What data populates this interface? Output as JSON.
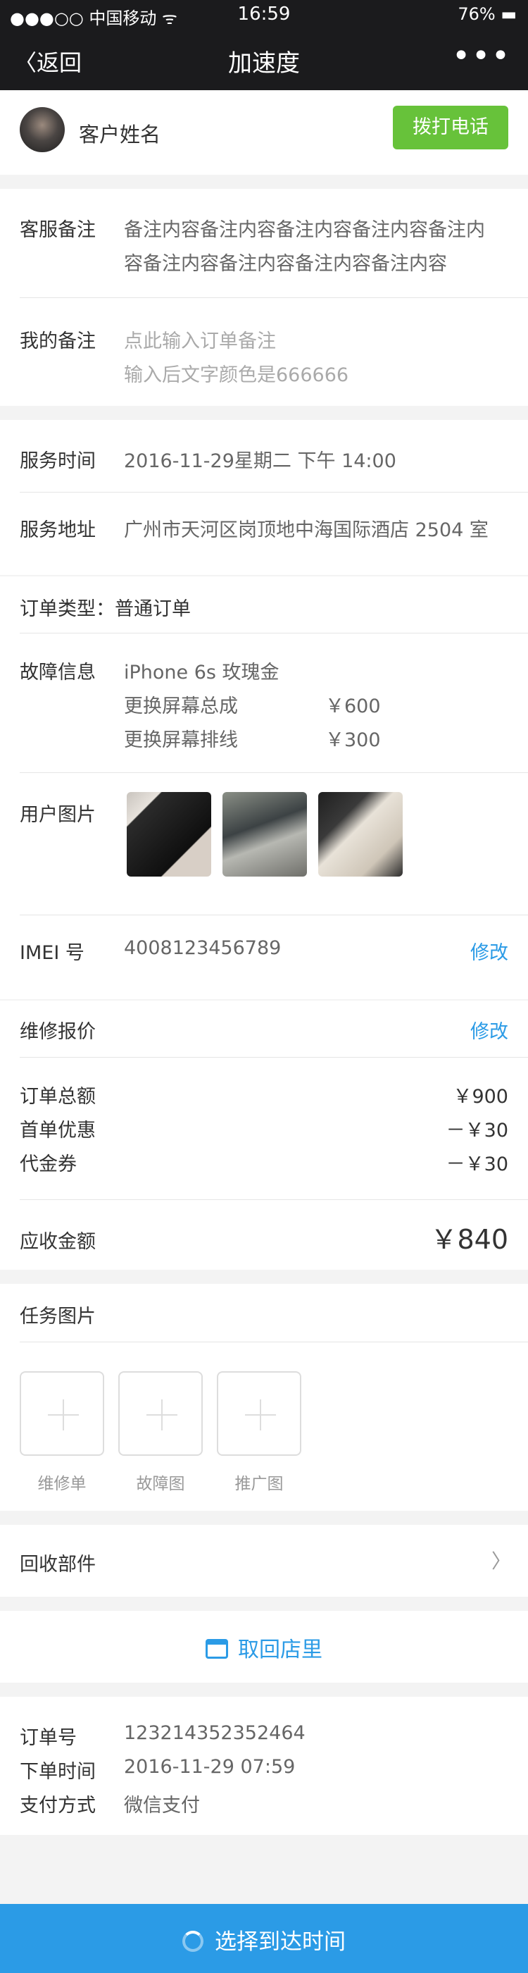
{
  "status_bar": {
    "carrier": "●●●○○ 中国移动 ᯤ",
    "time": "16:59",
    "battery": "76% ▬"
  },
  "nav": {
    "back_label": "返回",
    "title": "加速度",
    "more_label": "•••"
  },
  "customer": {
    "name": "客户姓名",
    "call_label": "拨打电话"
  },
  "notes": {
    "service_label": "客服备注",
    "service_line1": "备注内容备注内容备注内容备注内容备注内",
    "service_line2": "容备注内容备注内容备注内容备注内容",
    "my_label": "我的备注",
    "my_placeholder1": "点此输入订单备注",
    "my_placeholder2": "输入后文字颜色是666666"
  },
  "service": {
    "time_label": "服务时间",
    "time_value": "2016-11-29星期二 下午 14:00",
    "addr_label": "服务地址",
    "addr_value": "广州市天河区岗顶地中海国际酒店 2504 室"
  },
  "order": {
    "type_text": "订单类型：普通订单",
    "fault_label": "故障信息",
    "device": "iPhone 6s 玫瑰金",
    "fault_items": [
      {
        "name": "更换屏幕总成",
        "price": "￥600"
      },
      {
        "name": "更换屏幕排线",
        "price": "￥300"
      }
    ],
    "photos_label": "用户图片",
    "imei_label": "IMEI 号",
    "imei_value": "4008123456789",
    "edit_label": "修改"
  },
  "quote": {
    "title": "维修报价",
    "edit_label": "修改",
    "rows": [
      {
        "label": "订单总额",
        "value": "￥900"
      },
      {
        "label": "首单优惠",
        "value": "－￥30"
      },
      {
        "label": "代金券",
        "value": "－￥30"
      }
    ],
    "due_label": "应收金额",
    "due_value": "￥840"
  },
  "tasks": {
    "title": "任务图片",
    "items": [
      {
        "label": "维修单"
      },
      {
        "label": "故障图"
      },
      {
        "label": "推广图"
      }
    ]
  },
  "recycle": {
    "label": "回收部件",
    "chevron": "〉"
  },
  "fetch": {
    "label": "取回店里",
    "icon": "store-icon"
  },
  "order_info": {
    "no_label": "订单号",
    "no_value": "123214352352464",
    "time_label": "下单时间",
    "time_value": "2016-11-29 07:59",
    "pay_label": "支付方式",
    "pay_value": "微信支付"
  },
  "bottom": {
    "label": "选择到达时间"
  },
  "colors": {
    "accent": "#2b9be6",
    "call_green": "#67c23a",
    "nav_bg": "#1b1b1d"
  }
}
